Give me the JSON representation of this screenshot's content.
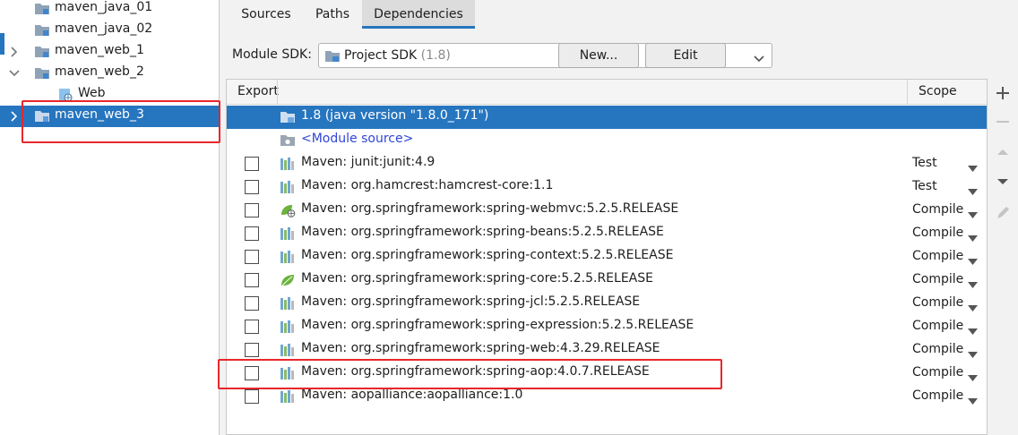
{
  "tree": {
    "items": [
      {
        "label": "maven_java_01",
        "arrow": "none",
        "level": 0,
        "icon": "module-folder-icon"
      },
      {
        "label": "maven_java_02",
        "arrow": "none",
        "level": 0,
        "icon": "module-folder-icon"
      },
      {
        "label": "maven_web_1",
        "arrow": "right",
        "level": 0,
        "icon": "module-folder-icon"
      },
      {
        "label": "maven_web_2",
        "arrow": "down",
        "level": 0,
        "icon": "module-folder-icon"
      },
      {
        "label": "Web",
        "arrow": "none",
        "level": 1,
        "icon": "web-facet-icon"
      },
      {
        "label": "maven_web_3",
        "arrow": "right",
        "level": 0,
        "icon": "module-folder-icon",
        "selected": true
      }
    ]
  },
  "tabs": [
    {
      "label": "Sources",
      "active": false
    },
    {
      "label": "Paths",
      "active": false
    },
    {
      "label": "Dependencies",
      "active": true
    }
  ],
  "sdk": {
    "label": "Module SDK:",
    "selected": "Project SDK",
    "version": "(1.8)",
    "new_button": "New...",
    "edit_button": "Edit"
  },
  "table": {
    "col_export": "Export",
    "col_scope": "Scope"
  },
  "deps": [
    {
      "name": "1.8 (java version \"1.8.0_171\")",
      "icon": "jdk-folder-icon",
      "checkbox": false,
      "scope": "",
      "selected": true
    },
    {
      "name": "<Module source>",
      "icon": "module-source-icon",
      "checkbox": false,
      "scope": "",
      "link": true
    },
    {
      "name": "Maven: junit:junit:4.9",
      "icon": "maven-library-icon",
      "checkbox": true,
      "scope": "Test"
    },
    {
      "name": "Maven: org.hamcrest:hamcrest-core:1.1",
      "icon": "maven-library-icon",
      "checkbox": true,
      "scope": "Test"
    },
    {
      "name": "Maven: org.springframework:spring-webmvc:5.2.5.RELEASE",
      "icon": "spring-web-icon",
      "checkbox": true,
      "scope": "Compile"
    },
    {
      "name": "Maven: org.springframework:spring-beans:5.2.5.RELEASE",
      "icon": "maven-library-icon",
      "checkbox": true,
      "scope": "Compile"
    },
    {
      "name": "Maven: org.springframework:spring-context:5.2.5.RELEASE",
      "icon": "maven-library-icon",
      "checkbox": true,
      "scope": "Compile"
    },
    {
      "name": "Maven: org.springframework:spring-core:5.2.5.RELEASE",
      "icon": "spring-leaf-icon",
      "checkbox": true,
      "scope": "Compile"
    },
    {
      "name": "Maven: org.springframework:spring-jcl:5.2.5.RELEASE",
      "icon": "maven-library-icon",
      "checkbox": true,
      "scope": "Compile"
    },
    {
      "name": "Maven: org.springframework:spring-expression:5.2.5.RELEASE",
      "icon": "maven-library-icon",
      "checkbox": true,
      "scope": "Compile"
    },
    {
      "name": "Maven: org.springframework:spring-web:4.3.29.RELEASE",
      "icon": "maven-library-icon",
      "checkbox": true,
      "scope": "Compile"
    },
    {
      "name": "Maven: org.springframework:spring-aop:4.0.7.RELEASE",
      "icon": "maven-library-icon",
      "checkbox": true,
      "scope": "Compile"
    },
    {
      "name": "Maven: aopalliance:aopalliance:1.0",
      "icon": "maven-library-icon",
      "checkbox": true,
      "scope": "Compile"
    }
  ],
  "toolbar": [
    "add-icon",
    "remove-icon",
    "move-up-icon",
    "move-down-icon",
    "edit-pencil-icon"
  ],
  "colors": {
    "selection": "#2675bf",
    "highlight": "#e8262b",
    "link": "#2f46d6"
  }
}
